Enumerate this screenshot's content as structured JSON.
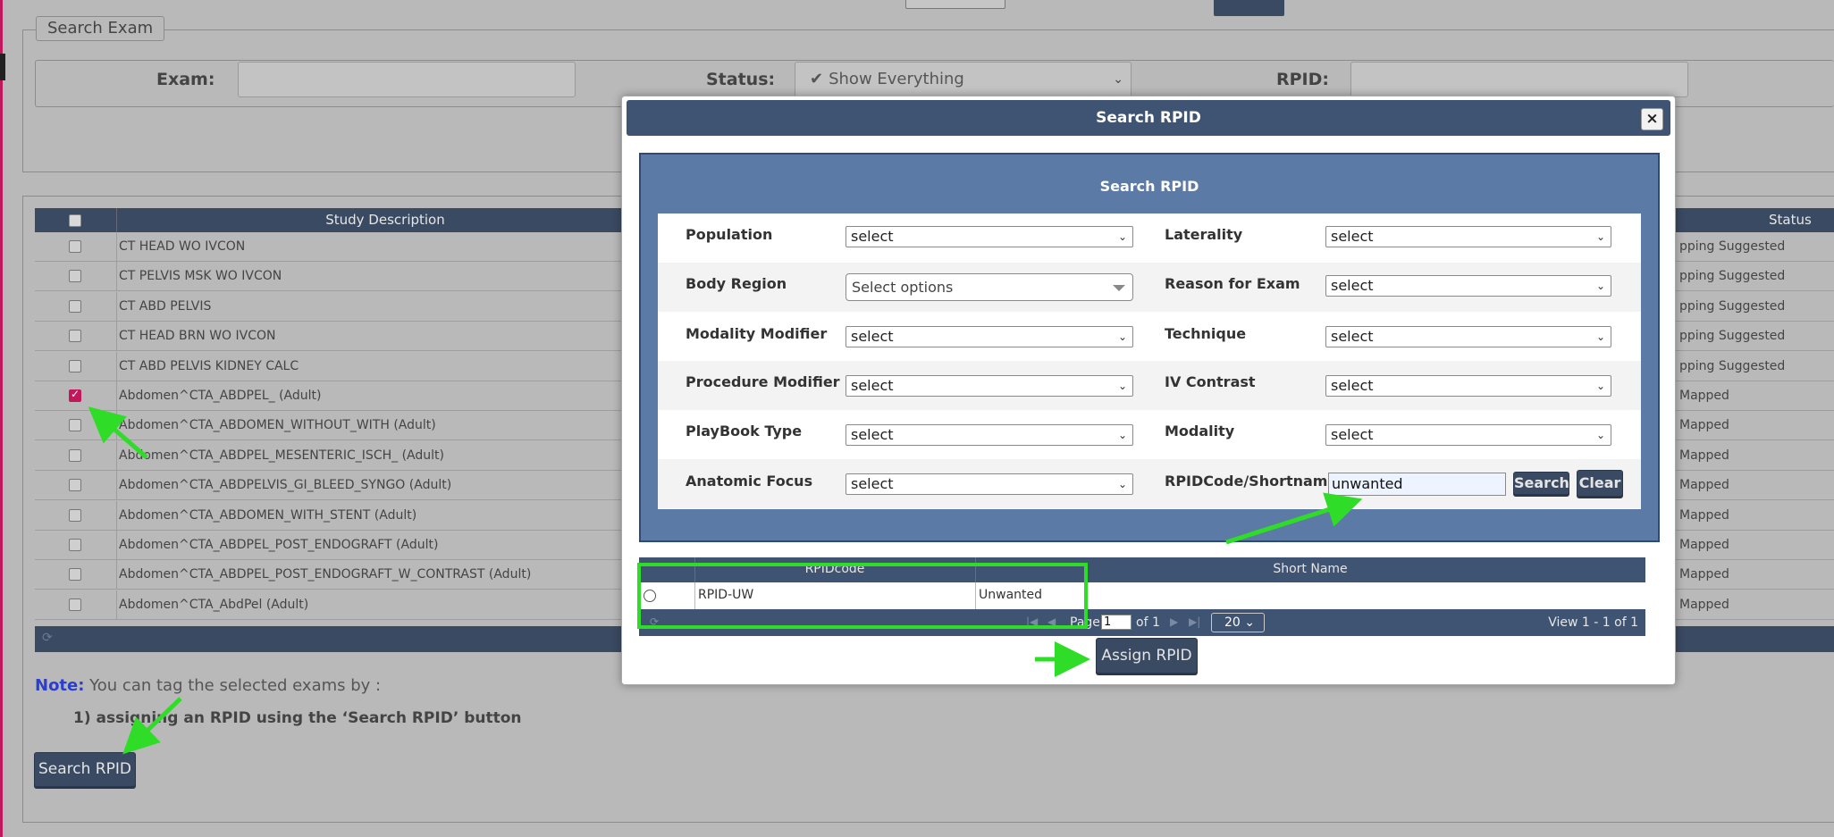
{
  "search_exam": {
    "legend": "Search Exam",
    "exam_label": "Exam:",
    "status_label": "Status:",
    "status_value": "Show Everything",
    "rpid_label": "RPID:"
  },
  "grid": {
    "col_description": "Study Description",
    "col_status": "Status",
    "rows": [
      {
        "description": "CT HEAD WO IVCON",
        "status": "pping Suggested",
        "checked": false
      },
      {
        "description": "CT PELVIS MSK WO IVCON",
        "status": "pping Suggested",
        "checked": false
      },
      {
        "description": "CT ABD PELVIS",
        "status": "pping Suggested",
        "checked": false
      },
      {
        "description": "CT HEAD BRN WO IVCON",
        "status": "pping Suggested",
        "checked": false
      },
      {
        "description": "CT ABD PELVIS KIDNEY CALC",
        "status": "pping Suggested",
        "checked": false
      },
      {
        "description": "Abdomen^CTA_ABDPEL_ (Adult)",
        "status": "Mapped",
        "checked": true
      },
      {
        "description": "Abdomen^CTA_ABDOMEN_WITHOUT_WITH (Adult)",
        "status": "Mapped",
        "checked": false
      },
      {
        "description": "Abdomen^CTA_ABDPEL_MESENTERIC_ISCH_ (Adult)",
        "status": "Mapped",
        "checked": false
      },
      {
        "description": "Abdomen^CTA_ABDPELVIS_GI_BLEED_SYNGO (Adult)",
        "status": "Mapped",
        "checked": false
      },
      {
        "description": "Abdomen^CTA_ABDOMEN_WITH_STENT (Adult)",
        "status": "Mapped",
        "checked": false
      },
      {
        "description": "Abdomen^CTA_ABDPEL_POST_ENDOGRAFT (Adult)",
        "status": "Mapped",
        "checked": false
      },
      {
        "description": "Abdomen^CTA_ABDPEL_POST_ENDOGRAFT_W_CONTRAST (Adult)",
        "status": "Mapped",
        "checked": false
      },
      {
        "description": "Abdomen^CTA_AbdPel (Adult)",
        "status": "Mapped",
        "checked": false
      }
    ]
  },
  "note": {
    "label": "Note:",
    "text": " You can tag the selected exams by :",
    "item1": "1) assigning an RPID using the ‘Search RPID’ button"
  },
  "search_rpid_button": "Search RPID",
  "modal": {
    "title": "Search RPID",
    "close_glyph": "×",
    "panel_title": "Search RPID",
    "fields": {
      "population": {
        "label": "Population",
        "value": "select"
      },
      "laterality": {
        "label": "Laterality",
        "value": "select"
      },
      "body_region": {
        "label": "Body Region",
        "value": "Select options"
      },
      "reason_for_exam": {
        "label": "Reason for Exam",
        "value": "select"
      },
      "modality_modifier": {
        "label": "Modality Modifier",
        "value": "select"
      },
      "technique": {
        "label": "Technique",
        "value": "select"
      },
      "procedure_modifier": {
        "label": "Procedure Modifier",
        "value": "select"
      },
      "iv_contrast": {
        "label": "IV Contrast",
        "value": "select"
      },
      "playbook_type": {
        "label": "PlayBook Type",
        "value": "select"
      },
      "modality": {
        "label": "Modality",
        "value": "select"
      },
      "anatomic_focus": {
        "label": "Anatomic Focus",
        "value": "select"
      },
      "rpid_code": {
        "label": "RPIDCode/Shortname",
        "value": "unwanted"
      }
    },
    "search_button": "Search",
    "clear_button": "Clear",
    "results": {
      "col_code": "RPIDcode",
      "col_short": "Short Name",
      "rows": [
        {
          "code": "RPID-UW",
          "short": "Unwanted"
        }
      ],
      "page_label": "Page",
      "page_value": "1",
      "of_label": "of 1",
      "page_size": "20",
      "view_text": "View 1 - 1 of 1"
    },
    "assign_button": "Assign RPID"
  },
  "colors": {
    "header_navy": "#3a4a62",
    "modal_title": "#3f5372",
    "panel_blue": "#5b7aa6",
    "annotation_green": "#2fdc27",
    "checkbox_checked": "#c2185b",
    "note_label": "#2a3fd1"
  }
}
